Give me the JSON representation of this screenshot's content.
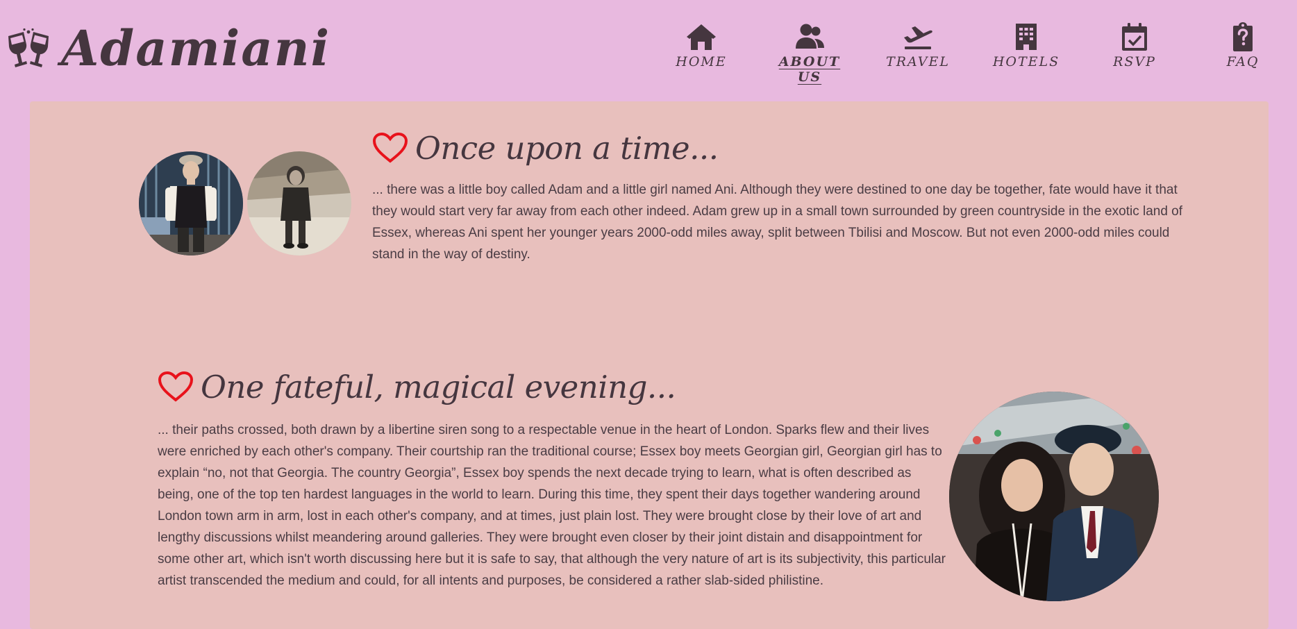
{
  "brand": {
    "name": "Adamiani",
    "icon": "champagne-glasses-icon"
  },
  "nav": {
    "items": [
      {
        "label": "HOME",
        "icon": "house-icon",
        "active": false
      },
      {
        "label": "ABOUT US",
        "icon": "users-icon",
        "active": true
      },
      {
        "label": "TRAVEL",
        "icon": "plane-departure-icon",
        "active": false
      },
      {
        "label": "HOTELS",
        "icon": "hotel-icon",
        "active": false
      },
      {
        "label": "RSVP",
        "icon": "calendar-check-icon",
        "active": false
      },
      {
        "label": "FAQ",
        "icon": "clipboard-question-icon",
        "active": false
      }
    ]
  },
  "colors": {
    "page_background": "#e8b9df",
    "panel_background": "#e8c0bd",
    "text": "#45363f",
    "heart": "#e8121b"
  },
  "sections": [
    {
      "heading": "Once upon a time...",
      "icon": "heart-outline-icon",
      "body": "... there was a little boy called Adam and a little girl named Ani. Although they were destined to one day be together, fate would have it that they would start very far away from each other indeed. Adam grew up in a small town surrounded by green countryside in the exotic land of Essex, whereas Ani spent her younger years 2000-odd miles away, split between Tbilisi and Moscow. But not even 2000-odd miles could stand in the way of destiny."
    },
    {
      "heading": "One fateful, magical evening...",
      "icon": "heart-outline-icon",
      "body": "... their paths crossed, both drawn by a libertine siren song to a respectable venue in the heart of London. Sparks flew and their lives were enriched by each other's company. Their courtship ran the traditional course; Essex boy meets Georgian girl, Georgian girl has to explain “no, not that Georgia. The country Georgia”, Essex boy spends the next decade trying to learn, what is often described as being, one of the top ten hardest languages in the world to learn. During this time, they spent their days together wandering around London town arm in arm, lost in each other's company, and at times, just plain lost. They were brought close by their love of art and lengthy discussions whilst meandering around galleries. They were brought even closer by their joint distain and disappointment for some other art, which isn't worth discussing here but it is safe to say, that although the very nature of art is its subjectivity, this particular artist transcended the medium and could, for all intents and purposes, be considered a rather slab-sided philistine."
    }
  ]
}
